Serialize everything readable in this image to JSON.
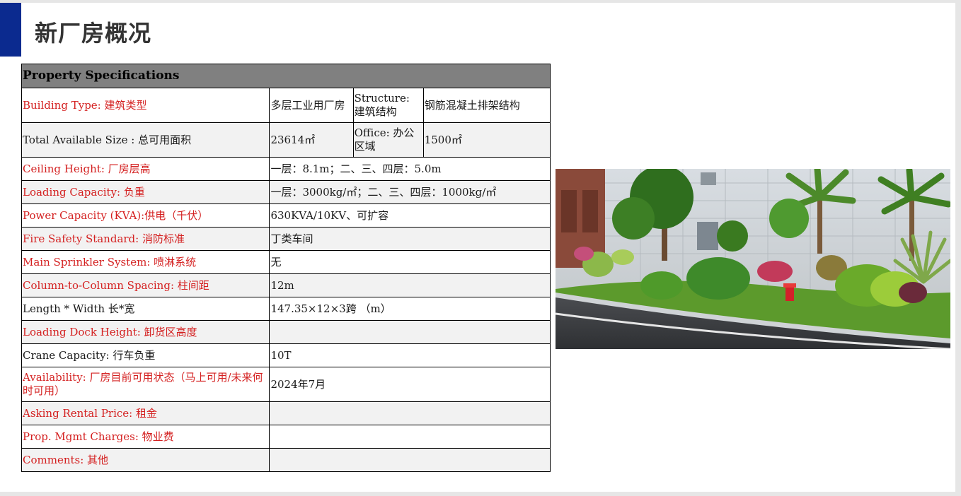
{
  "title": "新厂房概况",
  "table": {
    "header": "Property Specifications",
    "rows": [
      {
        "label": "Building Type: 建筑类型",
        "label_color": "red",
        "value": "多层工业用厂房",
        "label2": "Structure: 建筑结构",
        "value2": "钢筋混凝土排架结构"
      },
      {
        "label": "Total Available Size : 总可用面积",
        "label_color": "black",
        "value": "23614㎡",
        "label2": "Office: 办公区域",
        "value2": "1500㎡"
      },
      {
        "label": "Ceiling Height: 厂房层高",
        "label_color": "red",
        "value": "一层：8.1m；二、三、四层：5.0m"
      },
      {
        "label": "Loading Capacity: 负重",
        "label_color": "red",
        "value": "一层：3000kg/㎡；二、三、四层：1000kg/㎡"
      },
      {
        "label": "Power Capacity (KVA):供电（千伏）",
        "label_color": "red",
        "value": "630KVA/10KV、可扩容"
      },
      {
        "label": "Fire Safety Standard: 消防标准",
        "label_color": "red",
        "value": "丁类车间"
      },
      {
        "label": "Main Sprinkler System: 喷淋系统",
        "label_color": "red",
        "value": "无"
      },
      {
        "label": "Column-to-Column Spacing: 柱间距",
        "label_color": "red",
        "value": "12m"
      },
      {
        "label": "Length * Width 长*宽",
        "label_color": "black",
        "value": "147.35×12×3跨 （m）"
      },
      {
        "label": "Loading Dock Height: 卸货区高度",
        "label_color": "red",
        "value": ""
      },
      {
        "label": "Crane Capacity: 行车负重",
        "label_color": "black",
        "value": "10T"
      },
      {
        "label": "Availability: 厂房目前可用状态（马上可用/未来何时可用）",
        "label_color": "red",
        "value": "2024年7月"
      },
      {
        "label": "Asking Rental Price: 租金",
        "label_color": "red",
        "value": ""
      },
      {
        "label": "Prop. Mgmt Charges: 物业费",
        "label_color": "red",
        "value": ""
      },
      {
        "label": "Comments: 其他",
        "label_color": "red",
        "value": ""
      }
    ]
  },
  "colors": {
    "accent": "#0b2a8f",
    "label_red": "#d42020",
    "header_gray": "#808080"
  }
}
